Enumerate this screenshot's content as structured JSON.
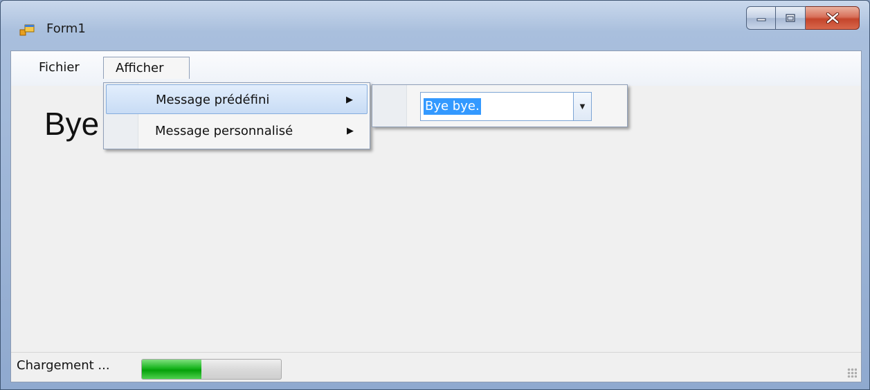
{
  "window": {
    "title": "Form1",
    "controls": {
      "minimize_icon": "minimize-icon",
      "maximize_icon": "maximize-icon",
      "close_icon": "close-icon"
    }
  },
  "menubar": {
    "items": [
      {
        "label": "Fichier"
      },
      {
        "label": "Afficher"
      }
    ]
  },
  "main": {
    "big_text": "Bye"
  },
  "dropdown": {
    "items": [
      {
        "label": "Message prédéfini",
        "highlighted": true,
        "arrow": "▶"
      },
      {
        "label": "Message personnalisé",
        "highlighted": false,
        "arrow": "▶"
      }
    ]
  },
  "submenu": {
    "combo": {
      "value": "Bye bye.",
      "arrow": "▼"
    }
  },
  "statusbar": {
    "label": "Chargement ...",
    "progress": 0.43
  },
  "colors": {
    "highlight": "#c8dcf5",
    "selection": "#3399ff",
    "progress": "#18b41e",
    "close_button": "#c4452c"
  }
}
